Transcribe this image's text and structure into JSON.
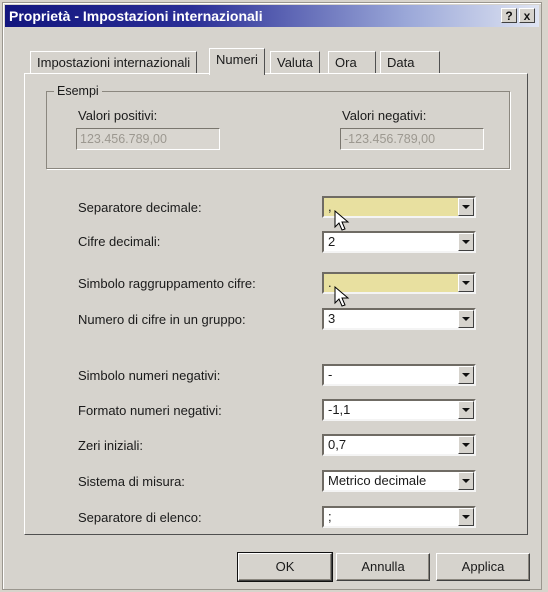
{
  "window": {
    "title": "Proprietà - Impostazioni internazionali",
    "help_button": "?",
    "close_button": "x"
  },
  "tabs": [
    {
      "label": "Impostazioni internazionali"
    },
    {
      "label": "Numeri"
    },
    {
      "label": "Valuta"
    },
    {
      "label": "Ora"
    },
    {
      "label": "Data"
    }
  ],
  "examples": {
    "group_label": "Esempi",
    "positive_label": "Valori positivi:",
    "positive_value": "123.456.789,00",
    "negative_label": "Valori negativi:",
    "negative_value": "-123.456.789,00"
  },
  "settings": [
    {
      "label": "Separatore decimale:",
      "value": ","
    },
    {
      "label": "Cifre decimali:",
      "value": "2"
    },
    {
      "label": "Simbolo raggruppamento cifre:",
      "value": "."
    },
    {
      "label": "Numero di cifre in un gruppo:",
      "value": "3"
    },
    {
      "label": "Simbolo numeri negativi:",
      "value": "-"
    },
    {
      "label": "Formato numeri negativi:",
      "value": "-1,1"
    },
    {
      "label": "Zeri iniziali:",
      "value": "0,7"
    },
    {
      "label": "Sistema di misura:",
      "value": "Metrico decimale"
    },
    {
      "label": "Separatore di elenco:",
      "value": ";"
    }
  ],
  "buttons": {
    "ok": "OK",
    "cancel": "Annulla",
    "apply": "Applica"
  },
  "colors": {
    "titlebar_start": "#13167e",
    "highlight": "#e8e0a0"
  }
}
